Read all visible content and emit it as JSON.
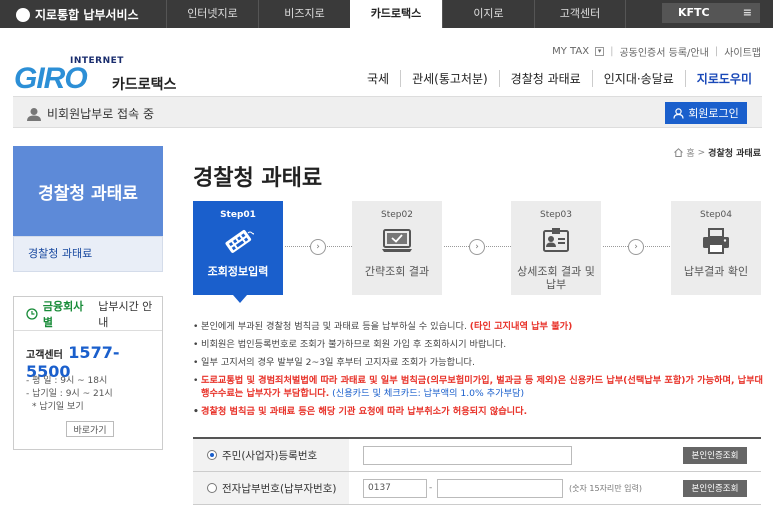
{
  "topnav": {
    "brand": "지로통합 납부서비스",
    "tabs": [
      "인터넷지로",
      "비즈지로",
      "카드로택스",
      "이지로",
      "고객센터"
    ],
    "kftc": "KFTC"
  },
  "header": {
    "util_links": [
      "MY TAX",
      "공동인증서 등록/안내",
      "사이트맵"
    ],
    "logo_internet": "INTERNET",
    "logo_giro": "GIRO",
    "logo_sub": "카드로택스",
    "gnb": [
      "국세",
      "관세(통고처분)",
      "경찰청 과태료",
      "인지대·송달료",
      "지로도우미"
    ]
  },
  "statusbar": {
    "user_text": "비회원납부로 접속 중",
    "login_label": "회원로그인"
  },
  "sidebar": {
    "title": "경찰청 과태료",
    "sub_item": "경찰청 과태료",
    "hours_title_pre": "금융회사별",
    "hours_title_post": "납부시간 안내",
    "callcenter_label": "고객센터",
    "callcenter_number": "1577-5500",
    "hours_weekday": "- 평    일 : 9시 ~ 18시",
    "hours_holiday": "- 납기일 : 9시 ~ 21시",
    "hours_note": "* 납기일 보기",
    "shortcut_label": "바로가기"
  },
  "main": {
    "breadcrumb_home": "홈",
    "breadcrumb_current": "경찰청 과태료",
    "title": "경찰청 과태료",
    "steps": [
      {
        "num": "Step01",
        "label": "조회정보입력",
        "icon": "card-keyboard-icon"
      },
      {
        "num": "Step02",
        "label": "간략조회 결과",
        "icon": "monitor-check-icon"
      },
      {
        "num": "Step03",
        "label": "상세조회 결과 및 납부",
        "icon": "id-card-icon"
      },
      {
        "num": "Step04",
        "label": "납부결과 확인",
        "icon": "printer-icon"
      }
    ],
    "notices": {
      "n1_text": "본인에게 부과된 경찰청 범칙금 및 과태료 등을 납부하실 수 있습니다.",
      "n1_red": "(타인 고지내역 납부 불가)",
      "n2": "비회원은 법인등록번호로 조회가 불가하므로 회원 가입 후 조회하시기 바랍니다.",
      "n3": "일부 고지서의 경우 발부일 2~3일 후부터 고지자료 조회가 가능합니다.",
      "n4_red": "도로교통법 및 경범죄처벌법에 따라 과태료 및 일부 범칙금(의무보험미가입, 벌과금 등 제외)은 신용카드 납부(선택납부 포함)가 가능하며, 납부대행수수료는 납부자가 부담합니다.",
      "n4_blue": "(신용카드 및 체크카드: 납부액의 1.0% 추가부담)",
      "n5_red": "경찰청 범칙금 및 과태료 등은 해당 기관 요청에 따라 납부취소가 허용되지 않습니다."
    },
    "form": {
      "row1_label": "주민(사업자)등록번호",
      "row2_label": "전자납부번호(납부자번호)",
      "row2_prefix": "0137",
      "row2_hint": "(숫자 15자리만 입력)",
      "cert_label": "본인인증조회"
    }
  }
}
